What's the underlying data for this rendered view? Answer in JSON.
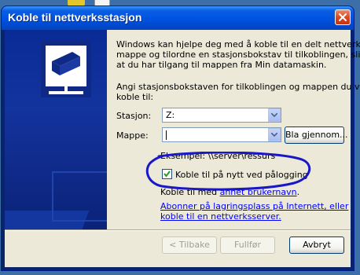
{
  "window": {
    "title": "Koble til nettverksstasjon"
  },
  "intro_lines": [
    "Windows kan hjelpe deg med å koble til en delt nettverks-",
    "mappe og tilordne en stasjonsbokstav til tilkoblingen, slik",
    "at du har tilgang til mappen fra Min datamaskin."
  ],
  "drive_prompt_lines": [
    "Angi stasjonsbokstaven for tilkoblingen og mappen du vil",
    "koble til:"
  ],
  "drive": {
    "label": "Stasjon:",
    "value": "Z:"
  },
  "folder": {
    "label": "Mappe:",
    "value": "",
    "browse_label": "Bla gjennom..."
  },
  "example_text": "Eksempel: \\\\server\\ressurs",
  "reconnect": {
    "label": "Koble til på nytt ved pålogging",
    "checked": true
  },
  "connect_as": {
    "prefix": "Koble til med ",
    "link": "annet brukernavn",
    "suffix": "."
  },
  "online_storage_link_lines": [
    "Abonner på lagringsplass på Internett, eller",
    "koble til en nettverksserver."
  ],
  "buttons": {
    "back": "< Tilbake",
    "finish": "Fullfør",
    "cancel": "Avbryt"
  },
  "colors": {
    "titlebar": "#0054e3",
    "side_panel": "#13339d",
    "annotation_ring": "#1a17c9",
    "link": "#0000ff"
  }
}
